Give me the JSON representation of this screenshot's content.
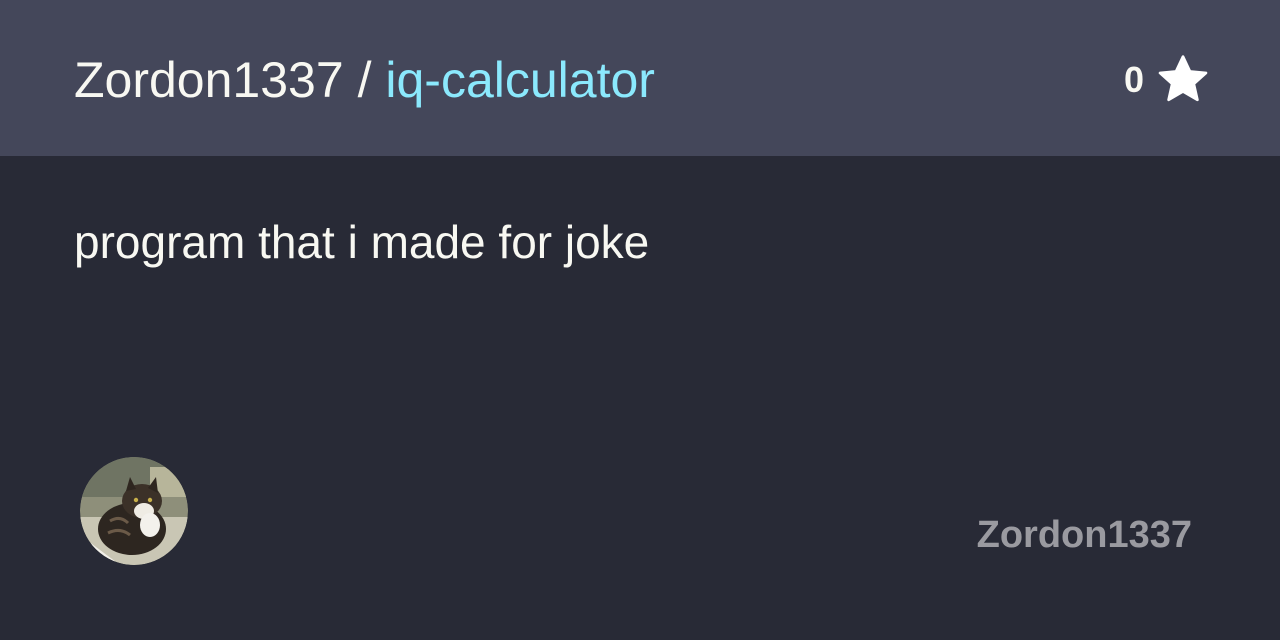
{
  "header": {
    "owner": "Zordon1337",
    "separator": "/",
    "repo_name": "iq-calculator",
    "star_count": "0",
    "star_icon": "star-icon"
  },
  "description": "program that i made for joke",
  "footer": {
    "avatar_icon": "cat-photo-avatar",
    "username": "Zordon1337"
  },
  "colors": {
    "background": "#282a36",
    "header_background": "#44475a",
    "text": "#f8f8f2",
    "accent": "#8be9fd",
    "muted": "#9a9aa0"
  }
}
